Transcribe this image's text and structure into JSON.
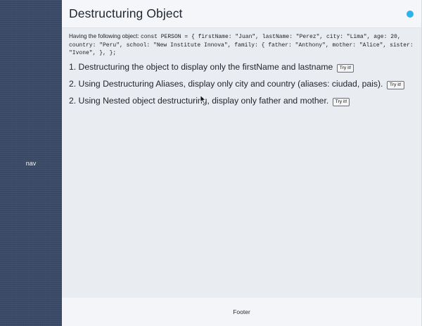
{
  "nav": {
    "label": "nav"
  },
  "header": {
    "title": "Destructuring Object",
    "status_color": "#2bb3ea"
  },
  "intro": {
    "lead": "Having the following object: ",
    "code": "const PERSON = { firstName: \"Juan\", lastName: \"Perez\", city: \"Lima\", age: 20, country: \"Peru\", school: \"New Institute Innova\", family: { father: \"Anthony\", mother: \"Alice\", sister: \"Ivone\", }, };"
  },
  "exercises": [
    {
      "text": "1. Destructuring the object to display only the firstName and lastname",
      "button_label": "Try it!"
    },
    {
      "text": "2. Using Destructuring Aliases, display only city and country (aliases: ciudad, pais).",
      "button_label": "Try it!"
    },
    {
      "text": "2. Using Nested object destructuring, display only father and mother.",
      "button_label": "Try it!"
    }
  ],
  "footer": {
    "label": "Footer"
  },
  "colors": {
    "nav_bg": "#3a4a66",
    "content_bg": "#e9ecf0",
    "header_bg": "#f4f6f9",
    "accent": "#2bb3ea"
  }
}
